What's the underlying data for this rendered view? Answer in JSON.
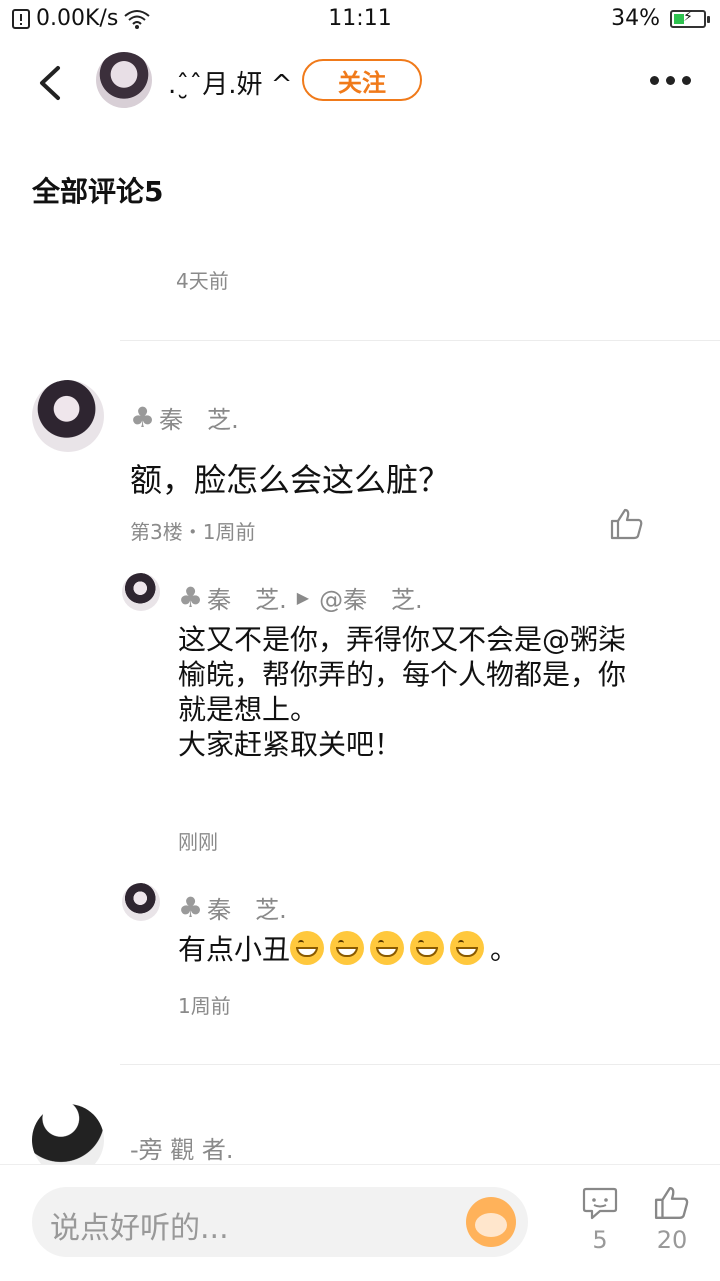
{
  "status_bar": {
    "network_speed": "0.00K/s",
    "time": "11:11",
    "battery": "34%",
    "battery_level": 0.34
  },
  "header": {
    "username": ".ˆ̮ˆ月.妍 ^",
    "follow_label": "关注"
  },
  "section": {
    "title": "全部评论5"
  },
  "comments": [
    {
      "time": "4天前"
    },
    {
      "user": "秦　芝.",
      "text": "额，脸怎么会这么脏？",
      "meta": "第3楼・1周前",
      "replies": [
        {
          "user": "秦　芝.",
          "reply_to": "@秦　芝.",
          "lines": [
            "这又不是你，弄得你又不会是@粥柒",
            "榆皖，帮你弄的，每个人物都是，你",
            "就是想上。",
            "大家赶紧取关吧！"
          ],
          "time": "刚刚"
        },
        {
          "user": "秦　芝.",
          "text": "有点小丑",
          "suffix": "。",
          "time": "1周前"
        }
      ]
    },
    {
      "user": "-旁 觀 者."
    }
  ],
  "bottom_bar": {
    "placeholder": "说点好听的...",
    "comment_count": "5",
    "like_count": "20"
  }
}
